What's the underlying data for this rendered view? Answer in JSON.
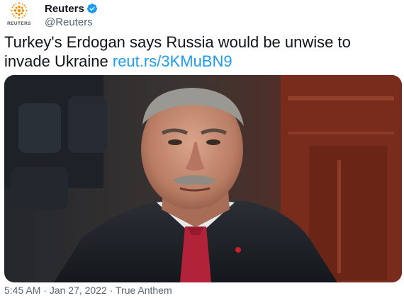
{
  "account": {
    "display_name": "Reuters",
    "handle": "@Reuters",
    "verified": true,
    "avatar_word": "REUTERS"
  },
  "tweet": {
    "text": "Turkey's Erdogan says Russia would be unwise to invade Ukraine",
    "link": "reut.rs/3KMuBN9"
  },
  "media": {
    "icon": "photo"
  },
  "meta": {
    "time": "5:45 AM",
    "separator": "·",
    "date": "Jan 27, 2022",
    "source": "True Anthem"
  },
  "colors": {
    "link": "#1d9bf0",
    "verified": "#1d9bf0",
    "secondary_text": "#536471",
    "brand_orange": "#f28b00"
  }
}
